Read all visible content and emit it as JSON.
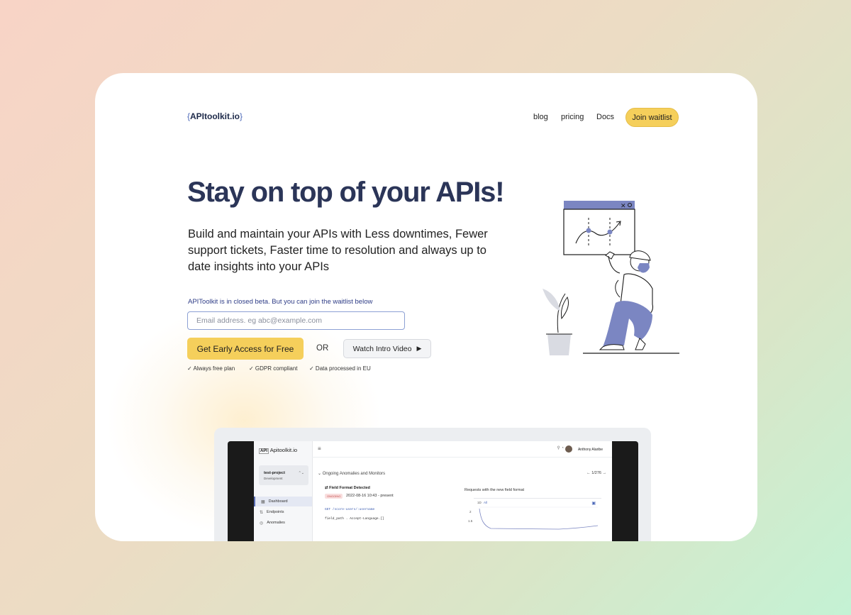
{
  "brand": {
    "open": "{",
    "name": "APItoolkit.io",
    "close": "}"
  },
  "nav": {
    "links": [
      "blog",
      "pricing",
      "Docs"
    ],
    "cta": "Join waitlist"
  },
  "hero": {
    "title": "Stay on top of your APIs!",
    "subtitle": "Build and maintain your APIs with Less downtimes, Fewer support tickets, Faster time to resolution and always up to date insights into your APIs",
    "beta_note": "APIToolkit is in closed beta. But you can join the waitlist below",
    "email_placeholder": "Email address. eg abc@example.com",
    "primary_cta": "Get Early Access for Free",
    "or_label": "OR",
    "video_cta": "Watch Intro Video",
    "features": [
      "✓ Always free plan",
      "✓ GDPR compliant",
      "✓ Data processed in EU"
    ]
  },
  "preview": {
    "logo_badge": "API",
    "logo_text": "Apitoolkit.io",
    "project": {
      "name": "test-project",
      "env": "Development"
    },
    "sidebar": [
      "Dashboard",
      "Endpoints",
      "Anomalies"
    ],
    "user": "Anthony Alaribe",
    "section_title": "Ongoing Anomalies and Monitors",
    "pager": "1/276",
    "anomaly": {
      "title": "Field Format Detected",
      "status": "ONGOING",
      "date": "2022-08-16 10:43  -  present",
      "endpoint": "GET /score-users/:username",
      "field": "field_path . Accept-Language.[]"
    },
    "chart": {
      "title": "Requests with the new field format",
      "range_labels": [
        "1D",
        "All"
      ],
      "y_ticks": [
        "2",
        "1.5"
      ]
    }
  },
  "colors": {
    "accent_yellow": "#f5cf5b",
    "title_navy": "#2b3558",
    "illustration_blue": "#7b86c2"
  }
}
